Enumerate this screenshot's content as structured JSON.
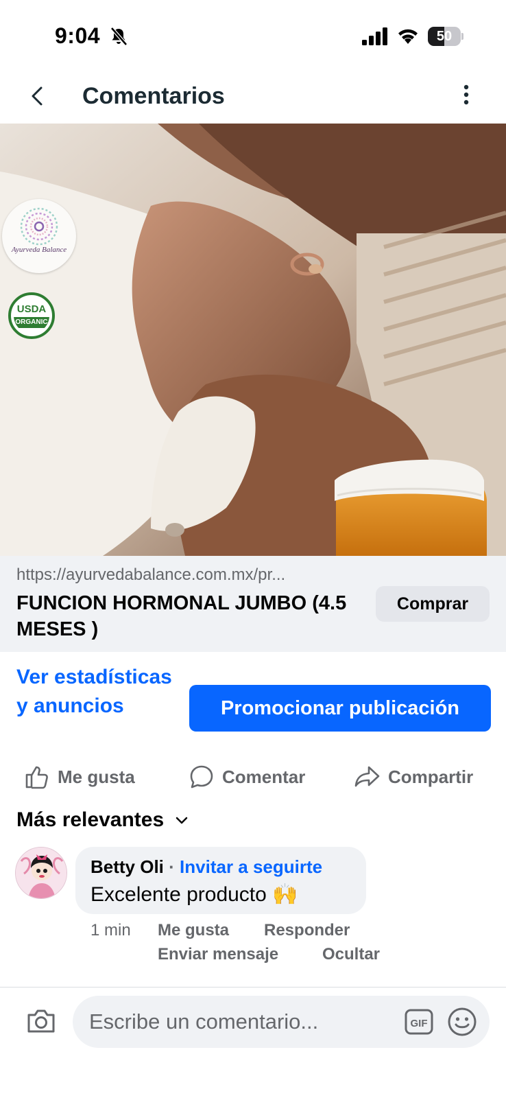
{
  "status_bar": {
    "time": "9:04",
    "battery": "50",
    "battery_level": 0.5
  },
  "header": {
    "title": "Comentarios"
  },
  "post": {
    "brand_badge": "Ayurveda Balance",
    "organic_badge_top": "USDA",
    "organic_badge_bottom": "ORGANIC"
  },
  "link_preview": {
    "url": "https://ayurvedabalance.com.mx/pr...",
    "title": "FUNCION HORMONAL JUMBO (4.5 MESES )",
    "cta": "Comprar"
  },
  "insights_link": "Ver estadísticas y anuncios",
  "promote_button": "Promocionar publicación",
  "actions": {
    "like": "Me gusta",
    "comment": "Comentar",
    "share": "Compartir"
  },
  "sort": {
    "label": "Más relevantes"
  },
  "comment": {
    "author": "Betty Oli",
    "separator": " · ",
    "follow": "Invitar a seguirte",
    "text": "Excelente producto 🙌",
    "time": "1 min",
    "like": "Me gusta",
    "reply": "Responder",
    "message": "Enviar mensaje",
    "hide": "Ocultar"
  },
  "composer": {
    "placeholder": "Escribe un comentario...",
    "gif_label": "GIF"
  },
  "colors": {
    "accent": "#0866ff",
    "secondary_text": "#65676b",
    "surface": "#f0f2f5"
  }
}
